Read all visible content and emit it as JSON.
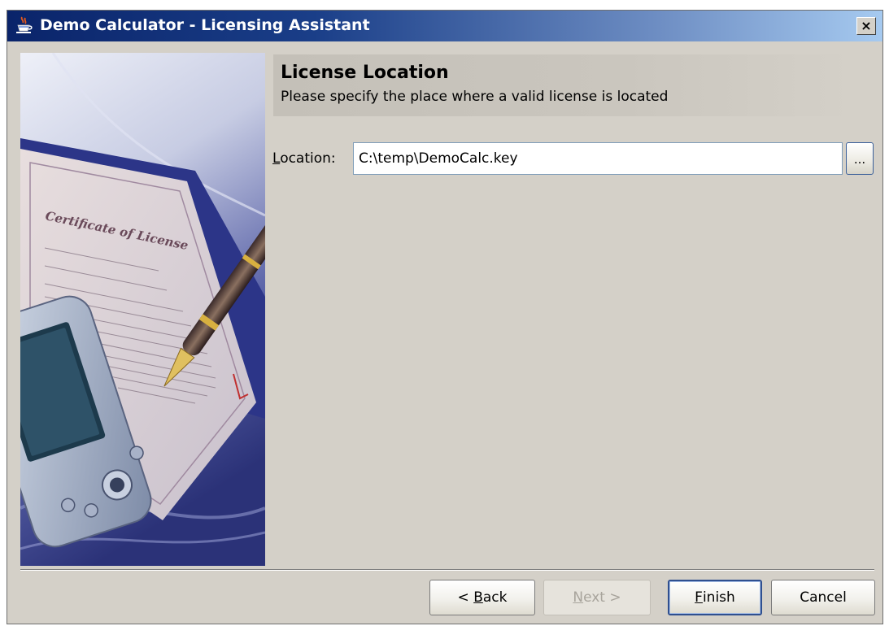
{
  "window": {
    "title": "Demo Calculator - Licensing Assistant",
    "close_label": "×"
  },
  "header": {
    "title": "License Location",
    "subtitle": "Please specify the place where a valid license is located"
  },
  "form": {
    "location_label_mnemonic": "L",
    "location_label_rest": "ocation:",
    "location_value": "C:\\temp\\DemoCalc.key",
    "browse_label": "..."
  },
  "buttons": {
    "back_prefix": "< ",
    "back_mnemonic": "B",
    "back_rest": "ack",
    "next_mnemonic": "N",
    "next_rest": "ext >",
    "finish_mnemonic": "F",
    "finish_rest": "inish",
    "cancel_label": "Cancel"
  },
  "side_image": {
    "certificate_heading": "Certificate of License"
  },
  "colors": {
    "titlebar_start": "#0a246a",
    "titlebar_end": "#a6caf0",
    "dialog_bg": "#d4d0c8",
    "input_border": "#7f9db9",
    "default_button_border": "#2f4f8f"
  },
  "icons": {
    "app": "java-cup-icon",
    "close": "close-icon",
    "browse": "ellipsis-icon"
  }
}
